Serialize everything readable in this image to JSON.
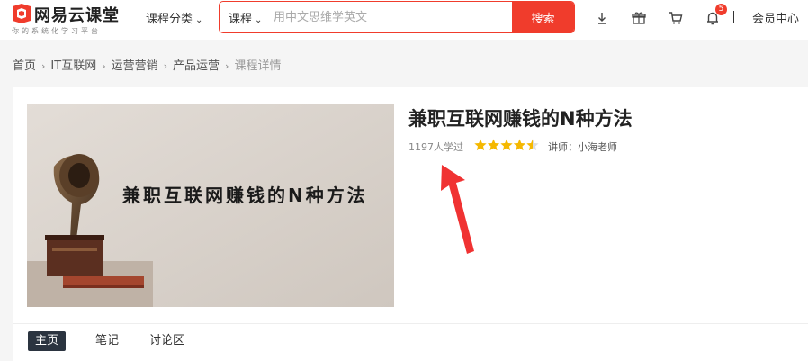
{
  "header": {
    "logo_title": "网易云课堂",
    "logo_subtitle": "你的系统化学习平台",
    "category_menu": "课程分类",
    "search": {
      "type": "课程",
      "placeholder": "用中文思维学英文",
      "button": "搜索"
    },
    "icons": [
      "download-icon",
      "gift-icon",
      "cart-icon",
      "bell-icon"
    ],
    "notification_count": "5",
    "member_center": "会员中心"
  },
  "breadcrumb": {
    "items": [
      "首页",
      "IT互联网",
      "运营营销",
      "产品运营"
    ],
    "current": "课程详情"
  },
  "course": {
    "cover_text": "兼职互联网赚钱的N种方法",
    "title": "兼职互联网赚钱的N种方法",
    "learners": "1197人学过",
    "rating": 4.5,
    "teacher": "讲师：小海老师"
  },
  "tabs": [
    {
      "label": "主页",
      "active": true
    },
    {
      "label": "笔记",
      "active": false
    },
    {
      "label": "讨论区",
      "active": false
    }
  ],
  "colors": {
    "brand": "#f03c2c",
    "star": "#f5b800",
    "tab_active": "#2b3440",
    "annotation_arrow": "#f03232"
  }
}
